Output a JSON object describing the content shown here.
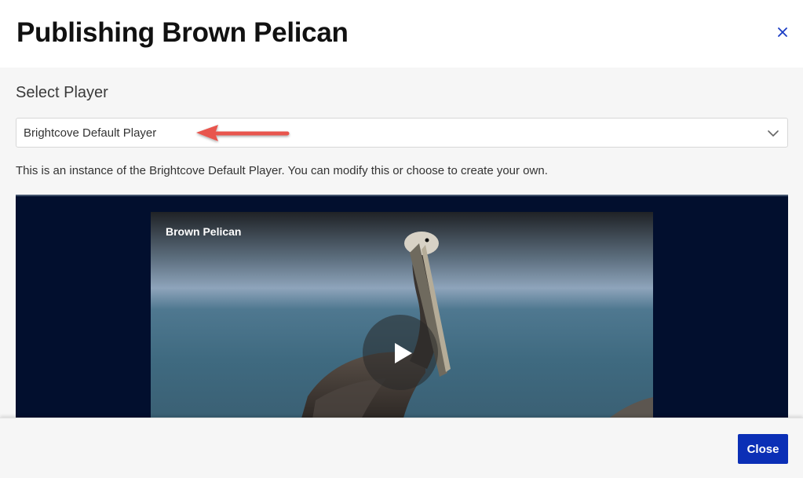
{
  "dialog": {
    "title": "Publishing Brown Pelican"
  },
  "player_select": {
    "label": "Select Player",
    "selected_value": "Brightcove Default Player",
    "description": "This is an instance of the Brightcove Default Player. You can modify this or choose to create your own."
  },
  "video": {
    "title": "Brown Pelican"
  },
  "footer": {
    "close_label": "Close"
  },
  "colors": {
    "primary_button": "#0b2fb6",
    "player_background": "#020f2e",
    "callout_arrow": "#e8544e",
    "close_x": "#1a3cc4"
  },
  "icons": [
    "close-icon",
    "chevron-down-icon",
    "play-icon",
    "callout-arrow"
  ]
}
